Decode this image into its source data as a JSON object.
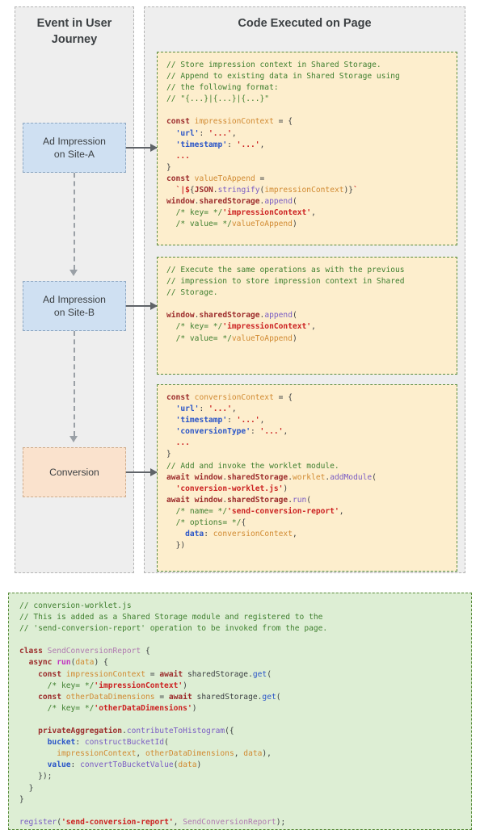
{
  "diagram": {
    "title": "Shared Storage impression and conversion flow",
    "columns": {
      "journey_header": "Event in User\nJourney",
      "code_header": "Code Executed on Page"
    },
    "journey_steps": [
      {
        "label": "Ad Impression\non Site-A",
        "color": "#cfe0f2"
      },
      {
        "label": "Ad Impression\non Site-B",
        "color": "#cfe0f2"
      },
      {
        "label": "Conversion",
        "color": "#fae2cd"
      }
    ],
    "code_blocks": [
      {
        "name": "impression-site-a-code",
        "background": "#fdeecd",
        "lines": [
          "// Store impression context in Shared Storage.",
          "// Append to existing data in Shared Storage using",
          "// the following format:",
          "// \"{...}|{...}|{...}\"",
          "",
          "const impressionContext = {",
          "  'url': '...',",
          "  'timestamp': '...',",
          "  ...",
          "}",
          "const valueToAppend =",
          "  `|${JSON.stringify(impressionContext)}`",
          "window.sharedStorage.append(",
          "  /* key= */'impressionContext',",
          "  /* value= */valueToAppend)"
        ]
      },
      {
        "name": "impression-site-b-code",
        "background": "#fdeecd",
        "lines": [
          "// Execute the same operations as with the previous",
          "// impression to store impression context in Shared",
          "// Storage.",
          "",
          "window.sharedStorage.append(",
          "  /* key= */'impressionContext',",
          "  /* value= */valueToAppend)"
        ]
      },
      {
        "name": "conversion-code",
        "background": "#fdeecd",
        "lines": [
          "const conversionContext = {",
          "  'url': '...',",
          "  'timestamp': '...',",
          "  'conversionType': '...',",
          "  ...",
          "}",
          "// Add and invoke the worklet module.",
          "await window.sharedStorage.worklet.addModule(",
          "  'conversion-worklet.js')",
          "await window.sharedStorage.run(",
          "  /* name= */'send-conversion-report',",
          "  /* options= */{",
          "    data: conversionContext,",
          "  })"
        ]
      }
    ],
    "worklet_block": {
      "name": "conversion-worklet-code",
      "background": "#ddeed4",
      "lines": [
        "// conversion-worklet.js",
        "// This is added as a Shared Storage module and registered to the",
        "// 'send-conversion-report' operation to be invoked from the page.",
        "",
        "class SendConversionReport {",
        "  async run(data) {",
        "    const impressionContext = await sharedStorage.get(",
        "      /* key= */'impressionContext')",
        "    const otherDataDimensions = await sharedStorage.get(",
        "      /* key= */'otherDataDimensions')",
        "",
        "    privateAggregation.contributeToHistogram({",
        "      bucket: constructBucketId(",
        "        impressionContext, otherDataDimensions, data),",
        "      value: convertToBucketValue(data)",
        "    });",
        "  }",
        "}",
        "",
        "register('send-conversion-report', SendConversionReport);"
      ]
    },
    "colors": {
      "panel_background": "#eeeeee",
      "panel_border": "#b4b4b4",
      "code_border": "#5a8c3c",
      "arrow": "#5f6368",
      "connector": "#9aa0a6",
      "comment": "#3f7f2f",
      "keyword": "#9c2c2c",
      "identifier": "#d18a32",
      "property_key": "#2a55c8",
      "string": "#cc2222",
      "function": "#7a5cc4",
      "class_name": "#b07ab0"
    }
  }
}
